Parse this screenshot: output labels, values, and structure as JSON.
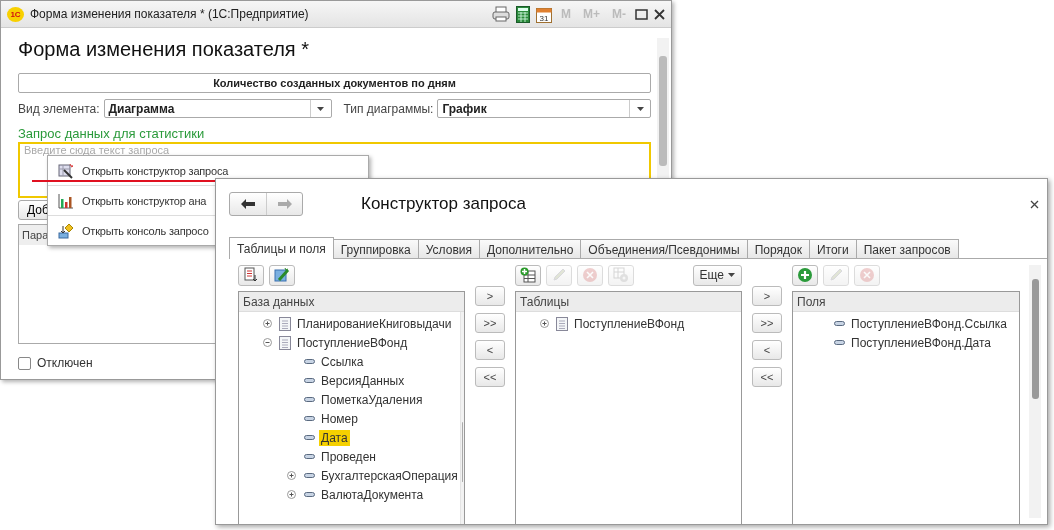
{
  "window": {
    "logo": "1С",
    "title": "Форма изменения показателя *",
    "app": "(1С:Предприятие)",
    "calendar_day": "31",
    "memory_buttons": [
      {
        "label": "M",
        "disabled": true
      },
      {
        "label": "M+",
        "disabled": true
      },
      {
        "label": "M-",
        "disabled": true
      }
    ]
  },
  "form": {
    "heading": "Форма изменения показателя *",
    "name_field": "Количество созданных документов по дням",
    "element_type": {
      "label": "Вид элемента:",
      "value": "Диаграмма"
    },
    "chart_type": {
      "label": "Тип диаграммы:",
      "value": "График"
    },
    "query_label": "Запрос данных для статистики",
    "query_field": {
      "placeholder": "Введите сюда текст запроса"
    },
    "add_button": "Доб",
    "params_column": "Пара",
    "off_checkbox": {
      "label": "Отключен",
      "checked": false
    }
  },
  "context_menu": [
    {
      "kind": "query",
      "label": "Открыть конструктор запроса"
    },
    {
      "kind": "chart",
      "label": "Открыть конструктор ана"
    },
    {
      "kind": "console",
      "label": "Открыть консоль запросо"
    }
  ],
  "dialog": {
    "title": "Конструктор запроса",
    "tabs": [
      {
        "label": "Таблицы и поля",
        "selected": true
      },
      {
        "label": "Группировка",
        "selected": false
      },
      {
        "label": "Условия",
        "selected": false
      },
      {
        "label": "Дополнительно",
        "selected": false
      },
      {
        "label": "Объединения/Псевдонимы",
        "selected": false
      },
      {
        "label": "Порядок",
        "selected": false
      },
      {
        "label": "Итоги",
        "selected": false
      },
      {
        "label": "Пакет запросов",
        "selected": false
      }
    ],
    "database": {
      "toolbar": [
        {
          "kind": "list",
          "disabled": false
        },
        {
          "kind": "wand",
          "disabled": false
        }
      ],
      "column": "База данных",
      "items": [
        {
          "kind": "table",
          "label": "ПланированиеКниговыдачи",
          "expanded": false,
          "selected": false
        },
        {
          "kind": "table",
          "label": "ПоступлениеВФонд",
          "expanded": true,
          "selected": false,
          "children": [
            {
              "kind": "field",
              "label": "Ссылка",
              "selected": false
            },
            {
              "kind": "field",
              "label": "ВерсияДанных",
              "selected": false
            },
            {
              "kind": "field",
              "label": "ПометкаУдаления",
              "selected": false
            },
            {
              "kind": "field",
              "label": "Номер",
              "selected": false
            },
            {
              "kind": "field",
              "label": "Дата",
              "selected": true
            },
            {
              "kind": "field",
              "label": "Проведен",
              "selected": false
            },
            {
              "kind": "field",
              "label": "БухгалтерскаяОперация",
              "expanded": false,
              "selected": false
            },
            {
              "kind": "field",
              "label": "ВалютаДокумента",
              "expanded": false,
              "selected": false
            }
          ]
        }
      ]
    },
    "move_buttons_left": [
      ">",
      ">>",
      "<",
      "<<"
    ],
    "tables": {
      "toolbar": [
        {
          "kind": "add-table",
          "disabled": false
        },
        {
          "kind": "edit",
          "disabled": true
        },
        {
          "kind": "delete",
          "disabled": true
        },
        {
          "kind": "settings",
          "disabled": true
        }
      ],
      "more_button": "Еще",
      "column": "Таблицы",
      "items": [
        {
          "kind": "table",
          "label": "ПоступлениеВФонд",
          "expanded": false,
          "selected": false
        }
      ]
    },
    "move_buttons_right": [
      ">",
      ">>",
      "<",
      "<<"
    ],
    "fields": {
      "toolbar": [
        {
          "kind": "add",
          "disabled": false
        },
        {
          "kind": "edit",
          "disabled": true
        },
        {
          "kind": "delete",
          "disabled": true
        }
      ],
      "column": "Поля",
      "items": [
        {
          "kind": "field",
          "label": "ПоступлениеВФонд.Ссылка",
          "selected": false
        },
        {
          "kind": "field",
          "label": "ПоступлениеВФонд.Дата",
          "selected": false
        }
      ]
    }
  }
}
